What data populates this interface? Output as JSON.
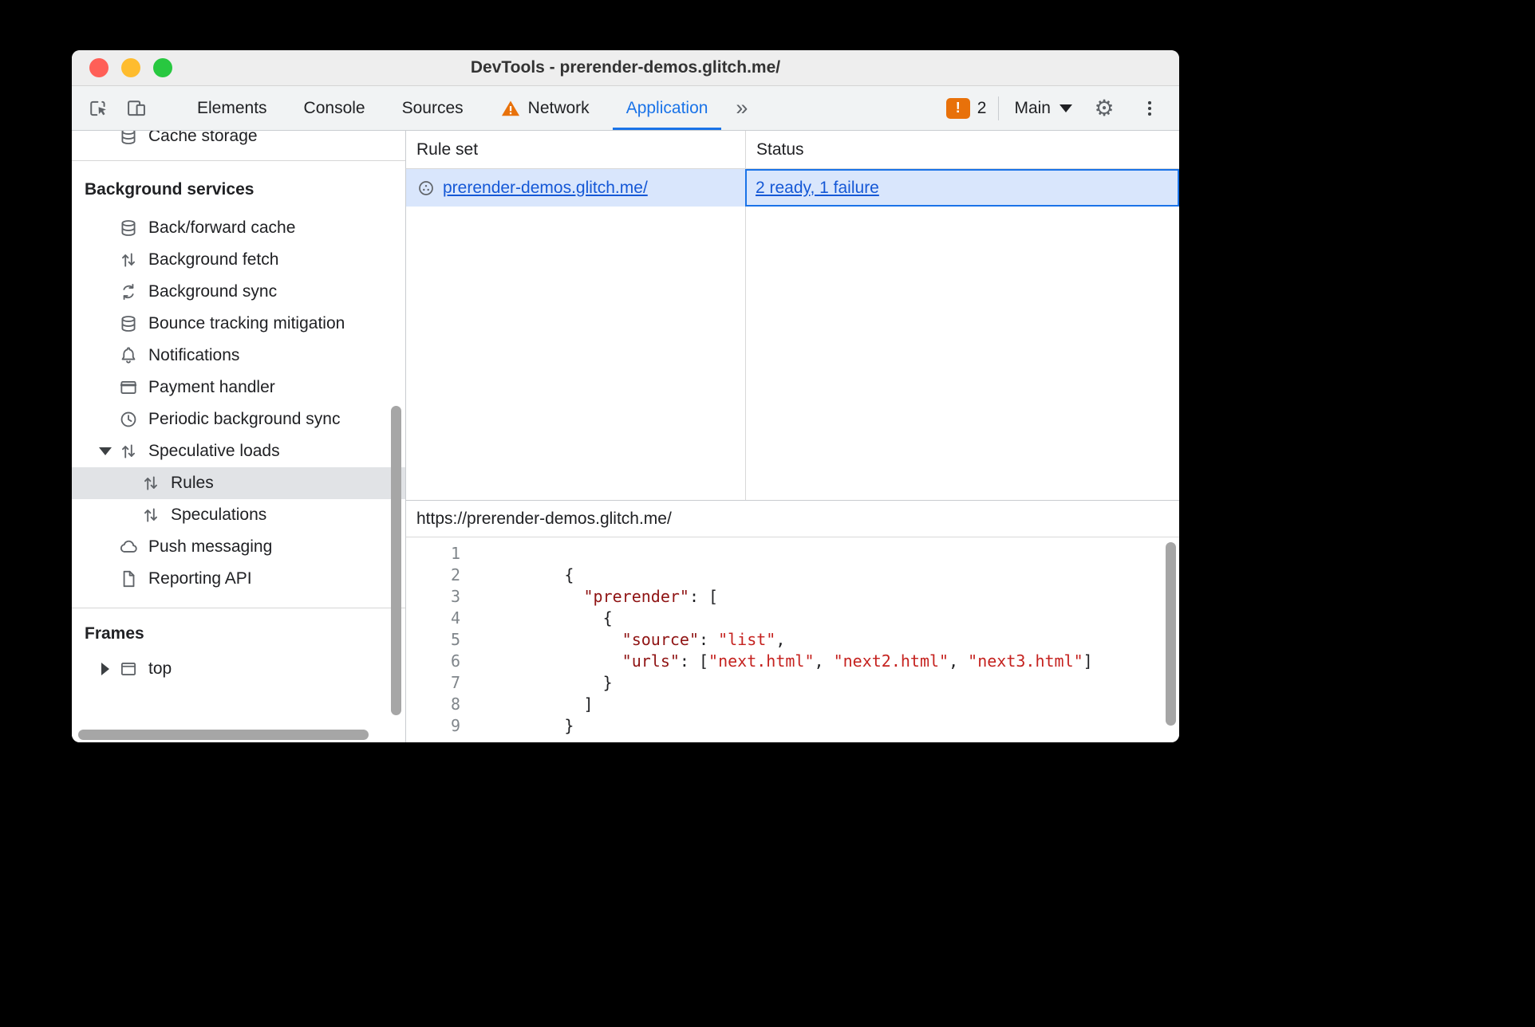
{
  "colors": {
    "accent_blue": "#1a73e8",
    "link_blue": "#1558d6",
    "selected_row_bg": "#d9e6fc",
    "sidebar_selected_bg": "#e1e3e6",
    "warning_orange": "#e8710a",
    "toolbar_bg": "#f1f3f4",
    "code_key": "#8f1313",
    "code_string": "#c5221f"
  },
  "window": {
    "title": "DevTools - prerender-demos.glitch.me/"
  },
  "toolbar": {
    "tabs": [
      {
        "label": "Elements"
      },
      {
        "label": "Console"
      },
      {
        "label": "Sources"
      },
      {
        "label": "Network"
      },
      {
        "label": "Application"
      }
    ],
    "more_tabs_label": "»",
    "issues": {
      "badge": "!",
      "count": "2"
    },
    "target_selector": {
      "label": "Main"
    }
  },
  "sidebar": {
    "clipped_item": {
      "label": "Cache storage"
    },
    "background_services": {
      "header": "Background services",
      "items": [
        {
          "label": "Back/forward cache"
        },
        {
          "label": "Background fetch"
        },
        {
          "label": "Background sync"
        },
        {
          "label": "Bounce tracking mitigation"
        },
        {
          "label": "Notifications"
        },
        {
          "label": "Payment handler"
        },
        {
          "label": "Periodic background sync"
        },
        {
          "label": "Speculative loads",
          "expanded": true
        },
        {
          "label": "Rules",
          "selected": true
        },
        {
          "label": "Speculations"
        },
        {
          "label": "Push messaging"
        },
        {
          "label": "Reporting API"
        }
      ]
    },
    "frames": {
      "header": "Frames",
      "items": [
        {
          "label": "top"
        }
      ]
    }
  },
  "rules_table": {
    "columns": [
      "Rule set",
      "Status"
    ],
    "rows": [
      {
        "rule_set": "prerender-demos.glitch.me/",
        "status": "2 ready, 1 failure"
      }
    ]
  },
  "preview": {
    "url": "https://prerender-demos.glitch.me/",
    "code_lines": [
      [],
      [
        {
          "c": "p",
          "t": "          {"
        }
      ],
      [
        {
          "c": "p",
          "t": "            "
        },
        {
          "c": "k",
          "t": "\"prerender\""
        },
        {
          "c": "p",
          "t": ": ["
        }
      ],
      [
        {
          "c": "p",
          "t": "              {"
        }
      ],
      [
        {
          "c": "p",
          "t": "                "
        },
        {
          "c": "k",
          "t": "\"source\""
        },
        {
          "c": "p",
          "t": ": "
        },
        {
          "c": "s",
          "t": "\"list\""
        },
        {
          "c": "p",
          "t": ","
        }
      ],
      [
        {
          "c": "p",
          "t": "                "
        },
        {
          "c": "k",
          "t": "\"urls\""
        },
        {
          "c": "p",
          "t": ": ["
        },
        {
          "c": "s",
          "t": "\"next.html\""
        },
        {
          "c": "p",
          "t": ", "
        },
        {
          "c": "s",
          "t": "\"next2.html\""
        },
        {
          "c": "p",
          "t": ", "
        },
        {
          "c": "s",
          "t": "\"next3.html\""
        },
        {
          "c": "p",
          "t": "]"
        }
      ],
      [
        {
          "c": "p",
          "t": "              }"
        }
      ],
      [
        {
          "c": "p",
          "t": "            ]"
        }
      ],
      [
        {
          "c": "p",
          "t": "          }"
        }
      ]
    ]
  }
}
